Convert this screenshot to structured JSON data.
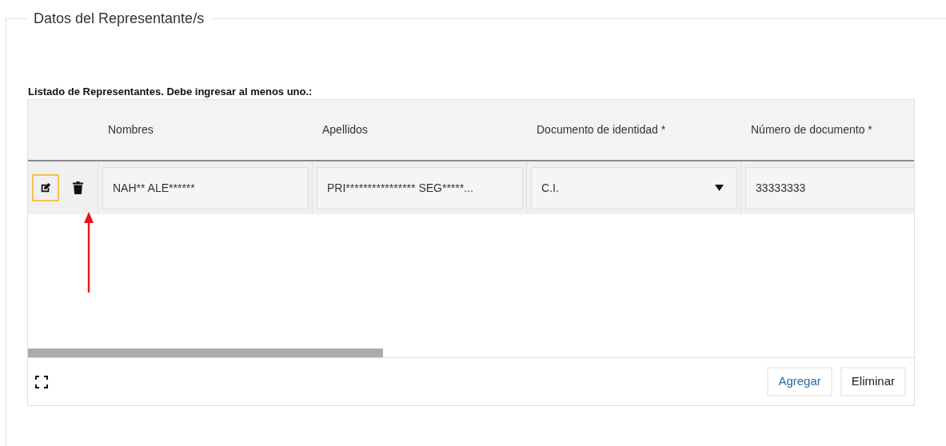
{
  "fieldset": {
    "legend": "Datos del Representante/s"
  },
  "list_label": "Listado de Representantes. Debe ingresar al menos uno.:",
  "table": {
    "columns": [
      "Nombres",
      "Apellidos",
      "Documento de identidad *",
      "Número de documento *"
    ],
    "rows": [
      {
        "actions": [
          {
            "kind": "edit",
            "focused": true
          },
          {
            "kind": "delete",
            "focused": false
          }
        ],
        "cells": [
          {
            "kind": "text",
            "value": "NAH** ALE******"
          },
          {
            "kind": "text",
            "value": "PRI**************** SEG*****..."
          },
          {
            "kind": "select",
            "value": "C.I."
          },
          {
            "kind": "text",
            "value": "33333333"
          }
        ]
      }
    ]
  },
  "footer": {
    "buttons": [
      {
        "label": "Agregar",
        "kind": "primary"
      },
      {
        "label": "Eliminar",
        "kind": "default"
      }
    ]
  }
}
